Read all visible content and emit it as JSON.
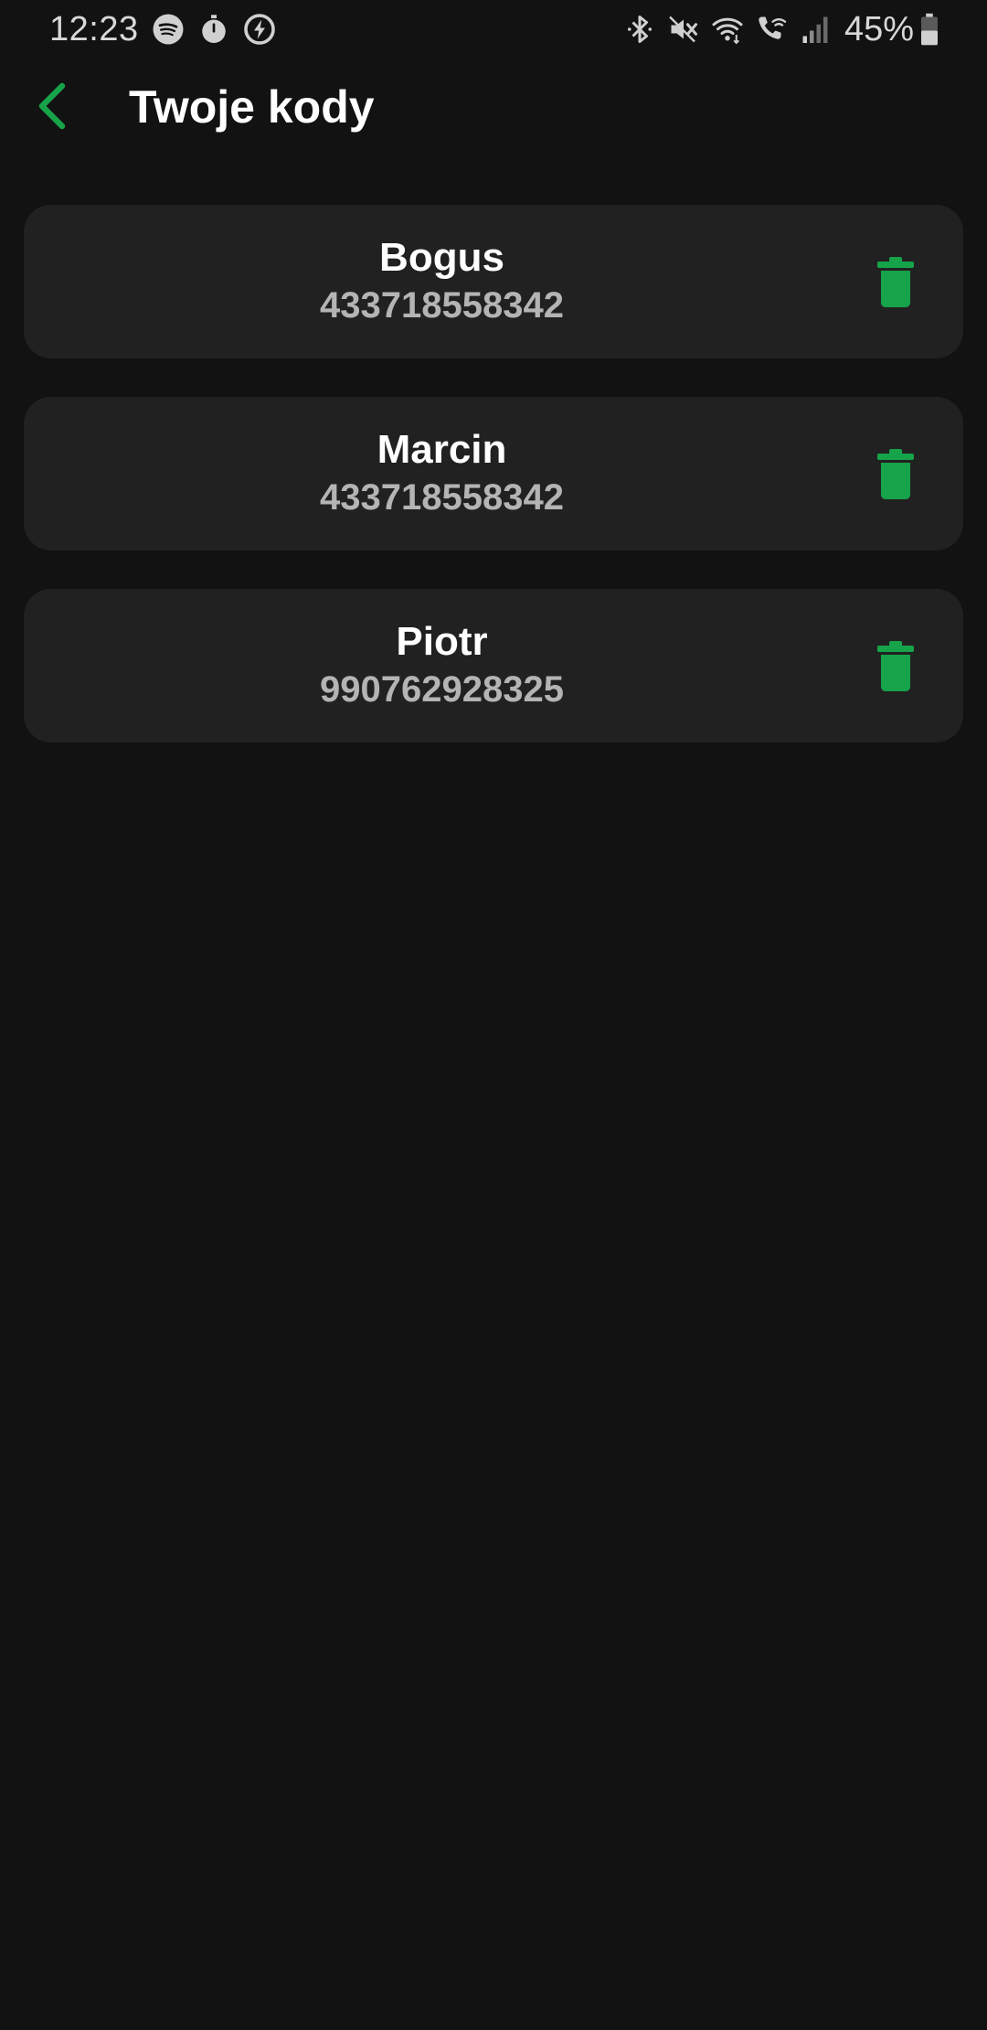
{
  "status_bar": {
    "time": "12:23",
    "left_icons": [
      "spotify-icon",
      "stopwatch-icon",
      "charging-bolt-icon"
    ],
    "right_icons": [
      "bluetooth-icon",
      "mute-icon",
      "wifi-icon",
      "wifi-calling-icon",
      "signal-icon"
    ],
    "battery_percent": "45%"
  },
  "app_bar": {
    "back_icon": "chevron-left-icon",
    "title": "Twoje kody"
  },
  "codes": [
    {
      "name": "Bogus",
      "number": "433718558342"
    },
    {
      "name": "Marcin",
      "number": "433718558342"
    },
    {
      "name": "Piotr",
      "number": "990762928325"
    }
  ],
  "colors": {
    "background": "#121212",
    "card": "#212121",
    "accent": "#16A34A",
    "title_text": "#FFFFFF",
    "secondary_text": "#B4B4B4"
  }
}
